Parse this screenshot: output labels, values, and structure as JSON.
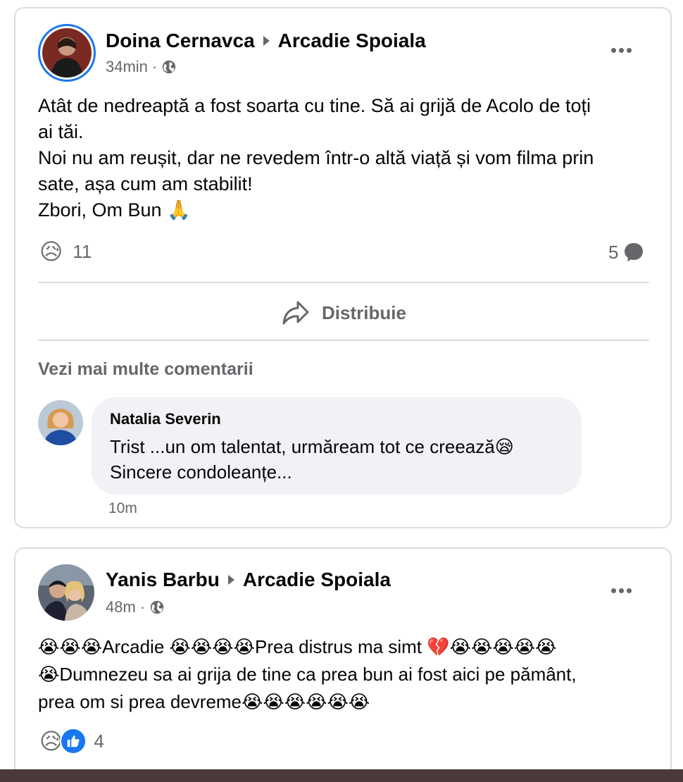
{
  "posts": [
    {
      "author": "Doina Cernavca",
      "target": "Arcadie Spoiala",
      "time": "34min",
      "visibility_icon": "globe-icon",
      "body": [
        "Atât de nedreaptă a fost soarta cu tine. Să ai grijă de Acolo de toți",
        "ai tăi.",
        "Noi nu am reușit, dar ne revedem într-o altă viață și vom filma prin",
        "sate, așa cum am stabilit!",
        "Zbori, Om Bun 🙏"
      ],
      "reaction_emoji": "😥",
      "reaction_count": "11",
      "comment_count": "5",
      "share_label": "Distribuie",
      "see_more_comments": "Vezi mai multe comentarii",
      "comment": {
        "author": "Natalia Severin",
        "line1": "Trist ...un om talentat, urmăream tot ce creează😪",
        "line2": "Sincere condoleanțe...",
        "time": "10m"
      }
    },
    {
      "author": "Yanis Barbu",
      "target": "Arcadie Spoiala",
      "time": "48m",
      "visibility_icon": "globe-icon",
      "body": [
        "😭😭😭Arcadie 😭😭😭😭Prea distrus ma simt 💔😭😭😭😭😭",
        "😭Dumnezeu sa ai grija de tine ca prea bun ai fost aici pe pământ,",
        "prea om si prea devreme😭😭😭😭😭😭"
      ],
      "reaction_emoji": "😥",
      "reaction_count": "4"
    }
  ],
  "colors": {
    "accent": "#1877f2",
    "secondary_text": "#65676b",
    "divider": "#dadde1",
    "bubble": "#f0f2f5"
  }
}
